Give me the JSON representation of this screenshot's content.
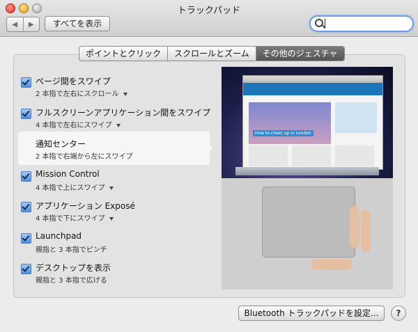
{
  "window": {
    "title": "トラックパッド"
  },
  "toolbar": {
    "show_all_label": "すべてを表示",
    "back_icon": "◀",
    "forward_icon": "▶"
  },
  "search": {
    "value": "",
    "placeholder": ""
  },
  "tabs": [
    {
      "label": "ポイントとクリック",
      "active": false
    },
    {
      "label": "スクロールとズーム",
      "active": false
    },
    {
      "label": "その他のジェスチャ",
      "active": true
    }
  ],
  "gestures": [
    {
      "label": "ページ間をスワイプ",
      "sub": "2 本指で左右にスクロール",
      "checked": true,
      "dropdown": true
    },
    {
      "label": "フルスクリーンアプリケーション間をスワイプ",
      "sub": "4 本指で左右にスワイプ",
      "checked": true,
      "dropdown": true
    },
    {
      "label": "通知センター",
      "sub": "2 本指で右端から左にスワイプ",
      "checked": false,
      "dropdown": false,
      "selected": true
    },
    {
      "label": "Mission Control",
      "sub": "4 本指で上にスワイプ",
      "checked": true,
      "dropdown": true
    },
    {
      "label": "アプリケーション Exposé",
      "sub": "4 本指で下にスワイプ",
      "checked": true,
      "dropdown": true
    },
    {
      "label": "Launchpad",
      "sub": "親指と 3 本指でピンチ",
      "checked": true,
      "dropdown": false
    },
    {
      "label": "デスクトップを表示",
      "sub": "親指と 3 本指で広げる",
      "checked": true,
      "dropdown": false
    }
  ],
  "preview": {
    "caption": "How to cheer up in London"
  },
  "footer": {
    "bluetooth_label": "Bluetooth トラックパッドを設定...",
    "help_label": "?"
  }
}
